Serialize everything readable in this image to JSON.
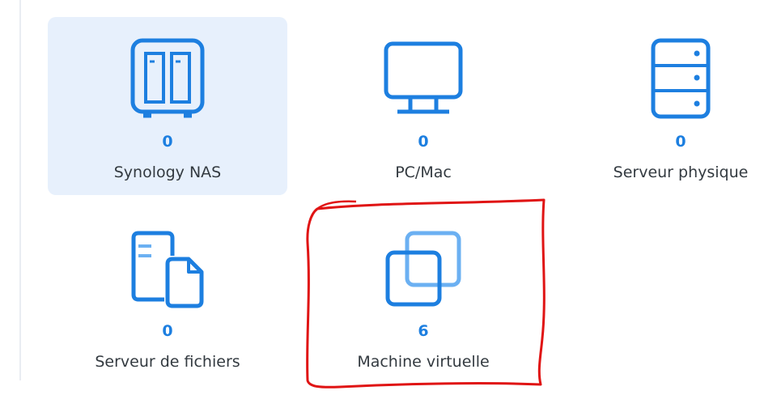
{
  "device_types": [
    {
      "label": "Synology NAS",
      "count": "0",
      "icon": "nas-icon",
      "selected": true
    },
    {
      "label": "PC/Mac",
      "count": "0",
      "icon": "monitor-icon",
      "selected": false
    },
    {
      "label": "Serveur physique",
      "count": "0",
      "icon": "server-icon",
      "selected": false
    },
    {
      "label": "Serveur de fichiers",
      "count": "0",
      "icon": "file-server-icon",
      "selected": false
    },
    {
      "label": "Machine virtuelle",
      "count": "6",
      "icon": "virtual-machine-icon",
      "selected": false
    }
  ],
  "colors": {
    "accent": "#1d7fe0",
    "icon_light": "#6bb0f2",
    "selected_bg": "#e7f0fc",
    "label": "#333a40",
    "annotation": "#e01414"
  }
}
